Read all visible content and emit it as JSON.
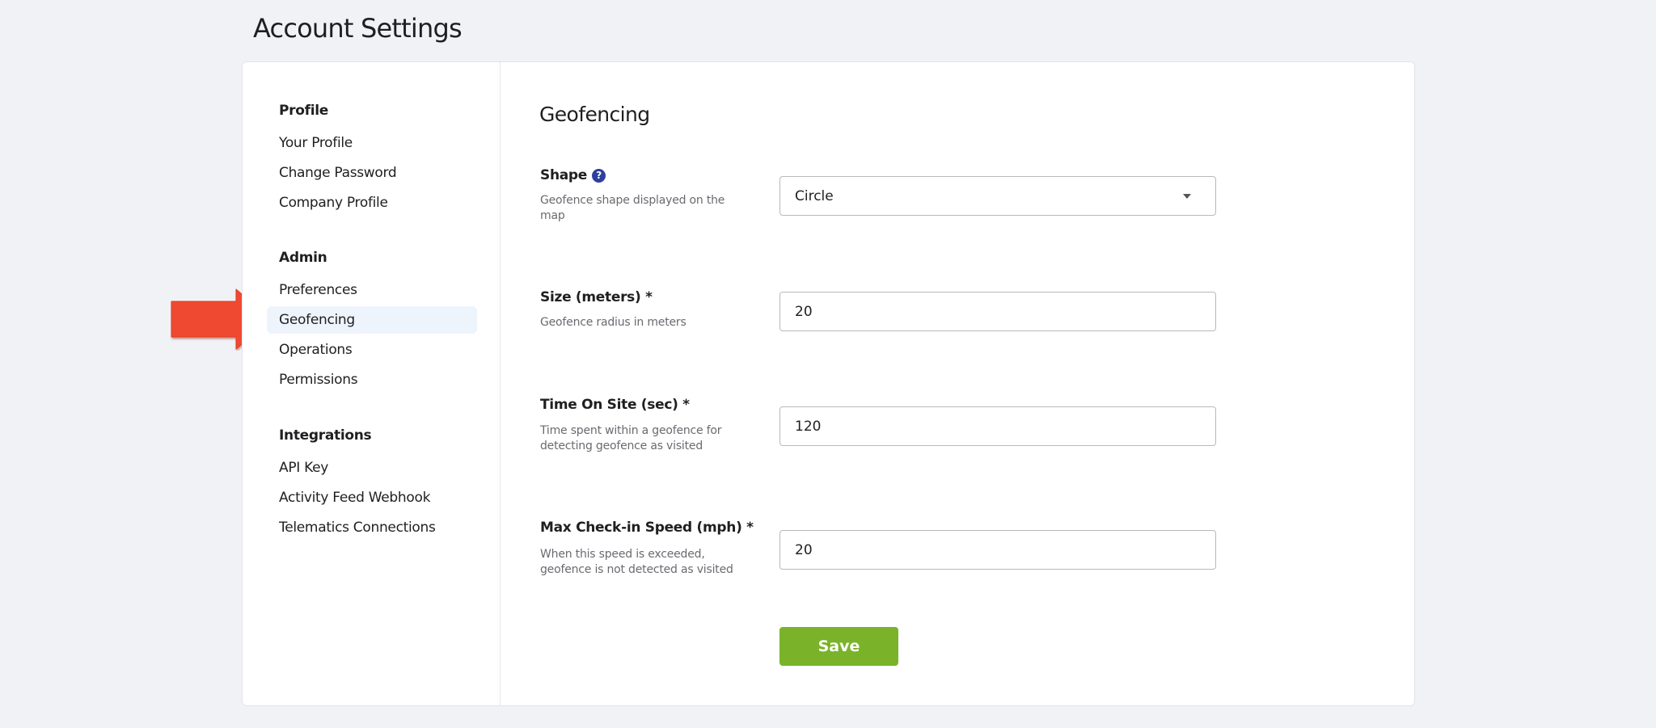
{
  "page": {
    "title": "Account Settings"
  },
  "sidebar": {
    "groups": [
      {
        "title": "Profile",
        "items": [
          {
            "label": "Your Profile"
          },
          {
            "label": "Change Password"
          },
          {
            "label": "Company Profile"
          }
        ]
      },
      {
        "title": "Admin",
        "items": [
          {
            "label": "Preferences"
          },
          {
            "label": "Geofencing",
            "active": true
          },
          {
            "label": "Operations"
          },
          {
            "label": "Permissions"
          }
        ]
      },
      {
        "title": "Integrations",
        "items": [
          {
            "label": "API Key"
          },
          {
            "label": "Activity Feed Webhook"
          },
          {
            "label": "Telematics Connections"
          }
        ]
      }
    ]
  },
  "main": {
    "section_title": "Geofencing",
    "fields": {
      "shape": {
        "label": "Shape",
        "description": "Geofence shape displayed on the map",
        "value": "Circle",
        "help_icon": "question-circle-icon"
      },
      "size": {
        "label": "Size (meters) *",
        "description": "Geofence radius in meters",
        "value": "20"
      },
      "time_on_site": {
        "label": "Time On Site (sec) *",
        "description": "Time spent within a geofence for detecting geofence as visited",
        "value": "120"
      },
      "max_speed": {
        "label": "Max Check-in Speed (mph) *",
        "description": "When this speed is exceeded, geofence is not detected as visited",
        "value": "20"
      }
    },
    "save_label": "Save"
  },
  "annotation": {
    "icon": "red-arrow-pointer-icon",
    "color": "#f04a32"
  },
  "colors": {
    "accent_green": "#7ab32a",
    "help_blue": "#2e3f9e",
    "active_item_bg": "#eef4fc"
  }
}
